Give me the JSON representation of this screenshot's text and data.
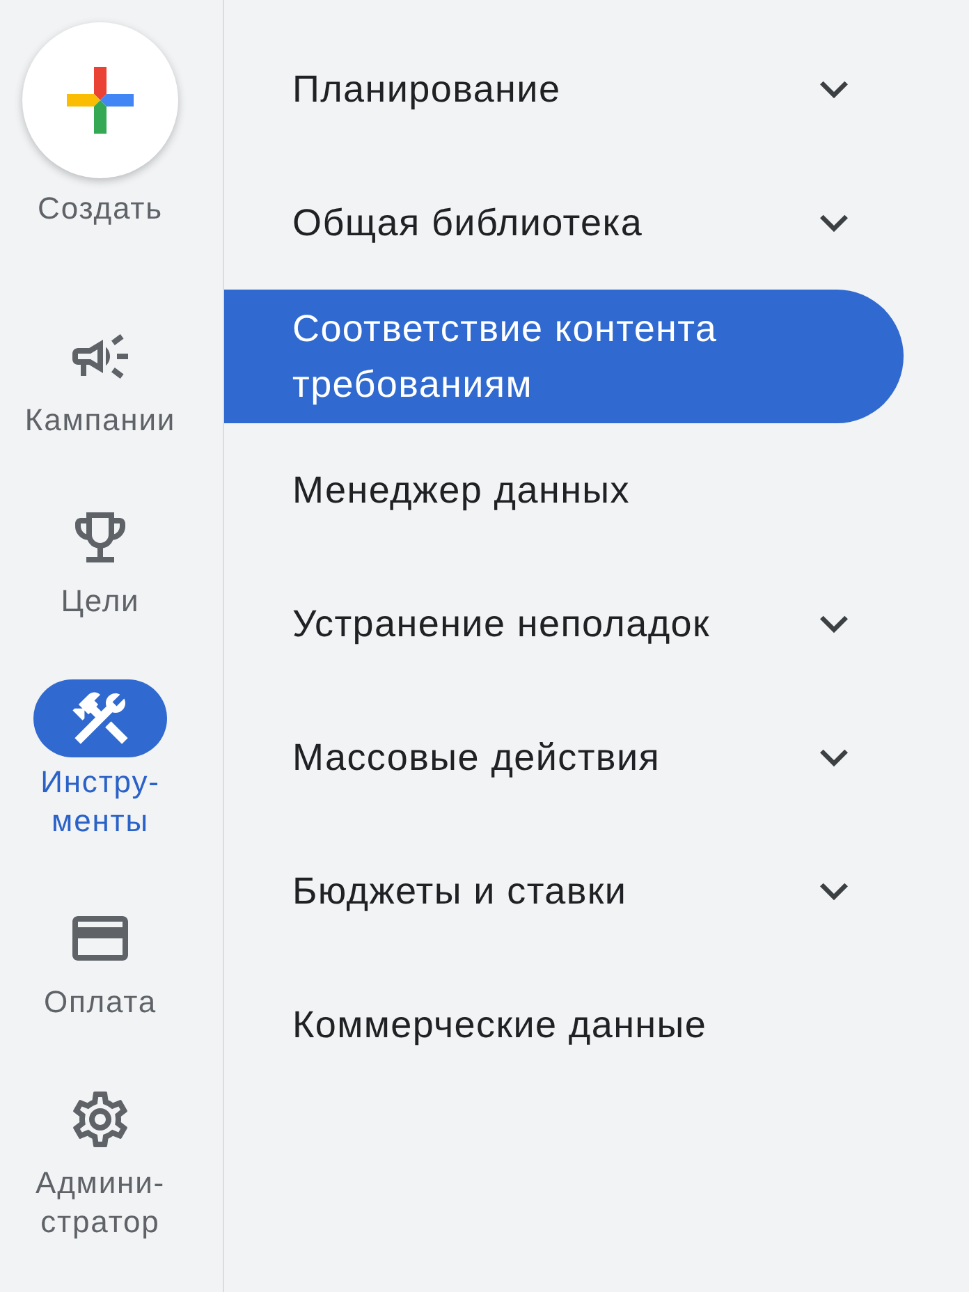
{
  "create": {
    "label": "Создать"
  },
  "nav": [
    {
      "kind": "campaigns",
      "label": "Кампании",
      "selected": false
    },
    {
      "kind": "goals",
      "label": "Цели",
      "selected": false
    },
    {
      "kind": "tools",
      "label": "Инстру-менты",
      "selected": true
    },
    {
      "kind": "billing",
      "label": "Оплата",
      "selected": false
    },
    {
      "kind": "admin",
      "label": "Админи-стратор",
      "selected": false
    }
  ],
  "menu": [
    {
      "label": "Планирование",
      "expandable": true,
      "selected": false
    },
    {
      "label": "Общая библиотека",
      "expandable": true,
      "selected": false
    },
    {
      "label": "Соответствие контента требованиям",
      "expandable": false,
      "selected": true
    },
    {
      "label": "Менеджер данных",
      "expandable": false,
      "selected": false
    },
    {
      "label": "Устранение неполадок",
      "expandable": true,
      "selected": false
    },
    {
      "label": "Массовые действия",
      "expandable": true,
      "selected": false
    },
    {
      "label": "Бюджеты и ставки",
      "expandable": true,
      "selected": false
    },
    {
      "label": "Коммерческие данные",
      "expandable": false,
      "selected": false
    }
  ]
}
